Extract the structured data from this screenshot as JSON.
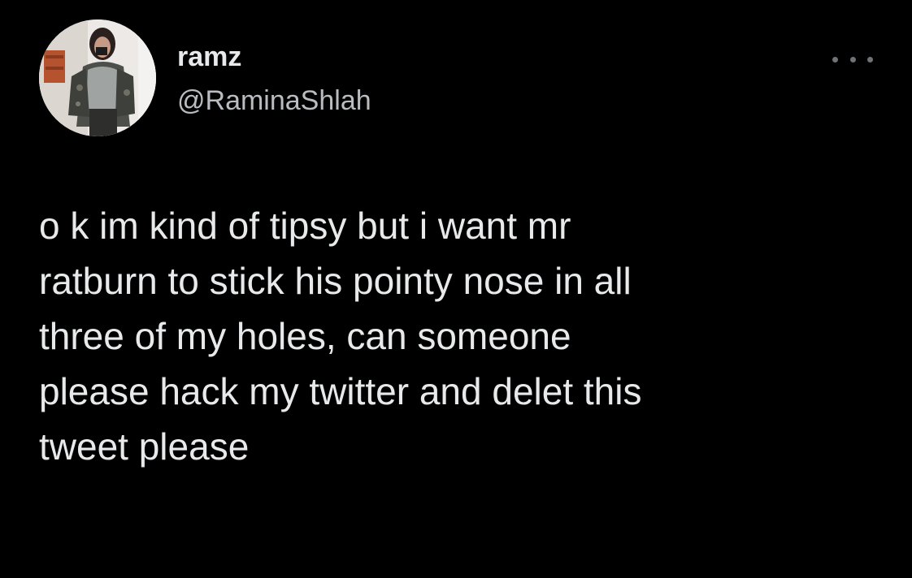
{
  "tweet": {
    "display_name": "ramz",
    "handle": "@RaminaShlah",
    "more_icon": "more-horizontal-icon",
    "text_lines": [
      "o k im kind of tipsy but i want mr",
      "ratburn to stick his pointy nose in all",
      "three of my holes, can someone",
      "please hack my twitter and delet this",
      "tweet please"
    ]
  },
  "colors": {
    "background": "#000000",
    "primary_text": "#e7e9ea",
    "secondary_text": "#b9bcc0",
    "icon": "#6e7378"
  }
}
